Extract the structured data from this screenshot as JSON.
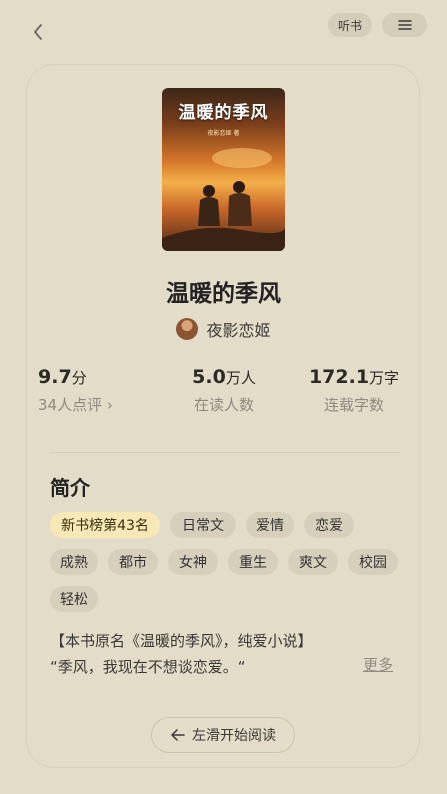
{
  "topbar": {
    "listen_label": "听书",
    "back_icon": "chevron-left-icon",
    "menu_icon": "hamburger-menu-icon"
  },
  "book": {
    "cover_title": "温暖的季风",
    "cover_author": "夜影恋姬 著",
    "title": "温暖的季风",
    "author": "夜影恋姬"
  },
  "stats": [
    {
      "num": "9.7",
      "unit": "分",
      "caption": "34人点评 ›"
    },
    {
      "num": "5.0",
      "unit": "万人",
      "caption": "在读人数"
    },
    {
      "num": "172.1",
      "unit": "万字",
      "caption": "连载字数"
    }
  ],
  "intro": {
    "heading": "简介",
    "tags": [
      "新书榜第43名",
      "日常文",
      "爱情",
      "恋爱",
      "成熟",
      "都市",
      "女神",
      "重生",
      "爽文",
      "校园",
      "轻松"
    ],
    "line1": "【本书原名《温暖的季风》，纯爱小说】",
    "line2": "“季风，我现在不想谈恋爱。“",
    "more": "更多"
  },
  "read_button": {
    "label": "左滑开始阅读"
  },
  "colors": {
    "background": "#e3dcc9",
    "tag": "#d6cfbb",
    "highlight_tag": "#f7e8b5"
  }
}
